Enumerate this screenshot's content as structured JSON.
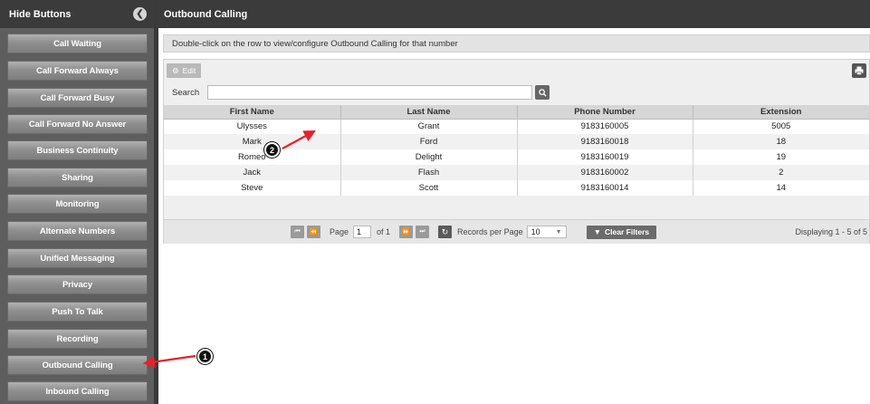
{
  "sidebar": {
    "title": "Hide Buttons",
    "collapse_icon": "chevron-left-icon",
    "items": [
      {
        "label": "Call Waiting"
      },
      {
        "label": "Call Forward Always"
      },
      {
        "label": "Call Forward Busy"
      },
      {
        "label": "Call Forward No Answer"
      },
      {
        "label": "Business Continuity"
      },
      {
        "label": "Sharing"
      },
      {
        "label": "Monitoring"
      },
      {
        "label": "Alternate Numbers"
      },
      {
        "label": "Unified Messaging"
      },
      {
        "label": "Privacy"
      },
      {
        "label": "Push To Talk"
      },
      {
        "label": "Recording"
      },
      {
        "label": "Outbound Calling"
      },
      {
        "label": "Inbound Calling"
      }
    ]
  },
  "main": {
    "title": "Outbound Calling",
    "instruction": "Double-click on the row to view/configure Outbound Calling for that number",
    "toolbar": {
      "edit_label": "Edit",
      "edit_icon": "gear-icon",
      "print_icon": "print-icon"
    },
    "search": {
      "label": "Search",
      "value": "",
      "icon": "search-icon"
    },
    "table": {
      "columns": [
        "First Name",
        "Last Name",
        "Phone Number",
        "Extension"
      ],
      "rows": [
        [
          "Ulysses",
          "Grant",
          "9183160005",
          "5005"
        ],
        [
          "Mark",
          "Ford",
          "9183160018",
          "18"
        ],
        [
          "Romeo",
          "Delight",
          "9183160019",
          "19"
        ],
        [
          "Jack",
          "Flash",
          "9183160002",
          "2"
        ],
        [
          "Steve",
          "Scott",
          "9183160014",
          "14"
        ]
      ]
    },
    "pager": {
      "page_label": "Page",
      "page_value": "1",
      "of_label": "of 1",
      "rpp_label": "Records per Page",
      "rpp_value": "10",
      "clear_filters_label": "Clear Filters",
      "display_text": "Displaying 1 - 5 of 5"
    }
  },
  "annotations": {
    "badge1": "1",
    "badge2": "2",
    "arrow_color": "#e8202a"
  }
}
